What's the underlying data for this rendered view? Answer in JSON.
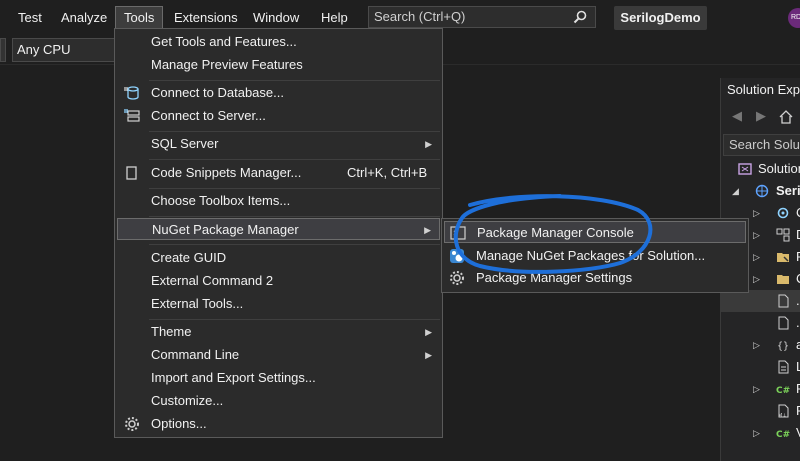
{
  "menubar": {
    "items": [
      "Test",
      "Analyze",
      "Tools",
      "Extensions",
      "Window",
      "Help"
    ],
    "search_placeholder": "Search (Ctrl+Q)",
    "solution_name": "SerilogDemo",
    "avatar_initials": "RD"
  },
  "toolbar": {
    "platform": "Any CPU"
  },
  "tools_menu": {
    "items": [
      {
        "label": "Get Tools and Features...",
        "icon": "none"
      },
      {
        "label": "Manage Preview Features",
        "icon": "none"
      },
      {
        "label": "Connect to Database...",
        "icon": "database-plug-icon"
      },
      {
        "label": "Connect to Server...",
        "icon": "server-plug-icon"
      },
      {
        "label": "SQL Server",
        "icon": "none",
        "submenu": true
      },
      {
        "label": "Code Snippets Manager...",
        "icon": "snippet-icon",
        "shortcut": "Ctrl+K, Ctrl+B"
      },
      {
        "label": "Choose Toolbox Items...",
        "icon": "none"
      },
      {
        "label": "NuGet Package Manager",
        "icon": "none",
        "submenu": true,
        "highlighted": true
      },
      {
        "label": "Create GUID",
        "icon": "none"
      },
      {
        "label": "External Command 2",
        "icon": "none"
      },
      {
        "label": "External Tools...",
        "icon": "none"
      },
      {
        "label": "Theme",
        "icon": "none",
        "submenu": true
      },
      {
        "label": "Command Line",
        "icon": "none",
        "submenu": true
      },
      {
        "label": "Import and Export Settings...",
        "icon": "none"
      },
      {
        "label": "Customize...",
        "icon": "none"
      },
      {
        "label": "Options...",
        "icon": "gear-icon"
      }
    ]
  },
  "nuget_submenu": {
    "items": [
      {
        "label": "Package Manager Console",
        "icon": "console-icon",
        "highlighted": true
      },
      {
        "label": "Manage NuGet Packages for Solution...",
        "icon": "nuget-icon"
      },
      {
        "label": "Package Manager Settings",
        "icon": "gear-icon"
      }
    ]
  },
  "annotation": {
    "color": "#1e6fd9"
  },
  "solution_explorer": {
    "title": "Solution Explorer",
    "search_placeholder": "Search Solution Explorer",
    "rows": [
      {
        "text": "Solution",
        "icon": "solution-icon"
      },
      {
        "text": "SerilogDemo",
        "icon": "project-icon"
      },
      {
        "text": "C",
        "icon": "connected-services-icon"
      },
      {
        "text": "D",
        "icon": "dependencies-icon"
      },
      {
        "text": "P",
        "icon": "properties-folder-icon"
      },
      {
        "text": "C",
        "icon": "folder-icon"
      },
      {
        "text": ".",
        "icon": "file-icon"
      },
      {
        "text": ".",
        "icon": "file-icon"
      },
      {
        "text": "a",
        "icon": "json-icon"
      },
      {
        "text": "L",
        "icon": "document-icon"
      },
      {
        "text": "F",
        "icon": "csharp-icon"
      },
      {
        "text": "F",
        "icon": "markdown-icon"
      },
      {
        "text": "V",
        "icon": "csharp-icon"
      }
    ]
  },
  "colors": {
    "background": "#1f1f1f",
    "menu_background": "#2b2b2b",
    "highlight": "#3e3e42",
    "annotation": "#1e6fd9"
  }
}
